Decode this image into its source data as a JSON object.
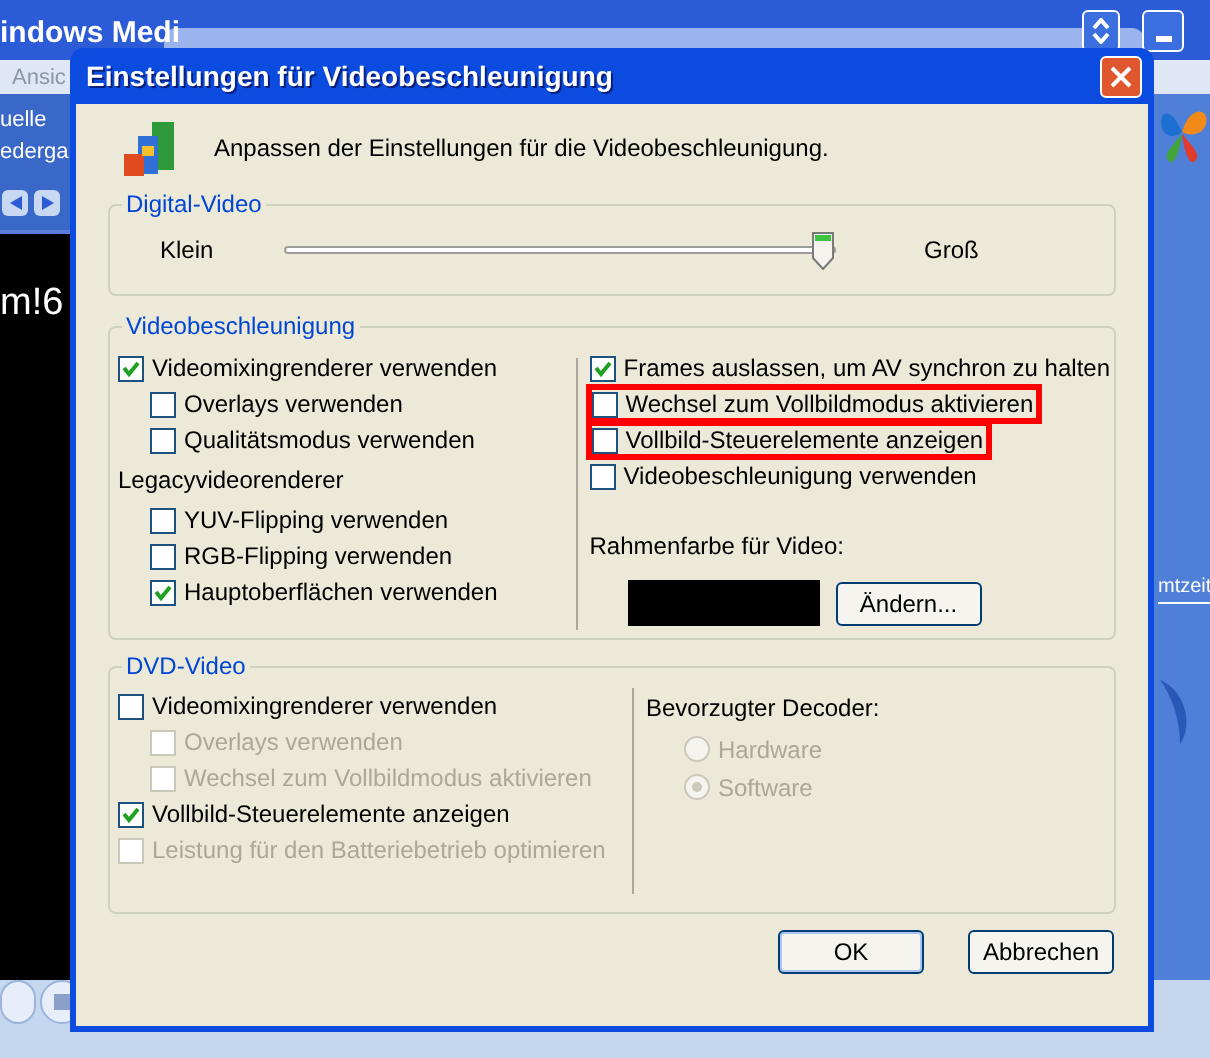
{
  "background": {
    "title_fragment": "indows Medi",
    "menu_fragment": "Ansic",
    "nav_fragments": [
      "uelle",
      "ederga"
    ],
    "video_text": "m!6",
    "side_fragment": "mtzeit"
  },
  "dialog": {
    "title": "Einstellungen für Videobeschleunigung",
    "description": "Anpassen der Einstellungen für die Videobeschleunigung.",
    "digital_video": {
      "legend": "Digital-Video",
      "min_label": "Klein",
      "max_label": "Groß",
      "slider": {
        "level": 0.98
      }
    },
    "video_acceleration": {
      "legend": "Videobeschleunigung",
      "left_items": [
        {
          "kind": "checkbox",
          "label": "Videomixingrenderer verwenden",
          "checked": true,
          "disabled": false,
          "indented": false,
          "highlighted": false
        },
        {
          "kind": "checkbox",
          "label": "Overlays verwenden",
          "checked": false,
          "disabled": false,
          "indented": true,
          "highlighted": false
        },
        {
          "kind": "checkbox",
          "label": "Qualitätsmodus verwenden",
          "checked": false,
          "disabled": false,
          "indented": true,
          "highlighted": false
        },
        {
          "kind": "heading",
          "label": "Legacyvideorenderer"
        },
        {
          "kind": "checkbox",
          "label": "YUV-Flipping verwenden",
          "checked": false,
          "disabled": false,
          "indented": true,
          "highlighted": false
        },
        {
          "kind": "checkbox",
          "label": "RGB-Flipping verwenden",
          "checked": false,
          "disabled": false,
          "indented": true,
          "highlighted": false
        },
        {
          "kind": "checkbox",
          "label": "Hauptoberflächen verwenden",
          "checked": true,
          "disabled": false,
          "indented": true,
          "highlighted": false
        }
      ],
      "right_items": [
        {
          "kind": "checkbox",
          "label": "Frames auslassen, um AV synchron zu halten",
          "checked": true,
          "disabled": false,
          "indented": false,
          "highlighted": false
        },
        {
          "kind": "checkbox",
          "label": "Wechsel zum Vollbildmodus aktivieren",
          "checked": false,
          "disabled": false,
          "indented": false,
          "highlighted": true
        },
        {
          "kind": "checkbox",
          "label": "Vollbild-Steuerelemente anzeigen",
          "checked": false,
          "disabled": false,
          "indented": false,
          "highlighted": true
        },
        {
          "kind": "checkbox",
          "label": "Videobeschleunigung verwenden",
          "checked": false,
          "disabled": false,
          "indented": false,
          "highlighted": false
        }
      ],
      "border_color_label": "Rahmenfarbe für Video:",
      "border_color": {
        "color": "#000000"
      },
      "change_button": "Ändern..."
    },
    "dvd_video": {
      "legend": "DVD-Video",
      "left_items": [
        {
          "kind": "checkbox",
          "label": "Videomixingrenderer verwenden",
          "checked": false,
          "disabled": false,
          "indented": false,
          "highlighted": false
        },
        {
          "kind": "checkbox",
          "label": "Overlays verwenden",
          "checked": false,
          "disabled": true,
          "indented": true,
          "highlighted": false
        },
        {
          "kind": "checkbox",
          "label": "Wechsel zum Vollbildmodus aktivieren",
          "checked": false,
          "disabled": true,
          "indented": true,
          "highlighted": false
        },
        {
          "kind": "checkbox",
          "label": "Vollbild-Steuerelemente anzeigen",
          "checked": true,
          "disabled": false,
          "indented": false,
          "highlighted": false
        },
        {
          "kind": "checkbox",
          "label": "Leistung für den Batteriebetrieb optimieren",
          "checked": false,
          "disabled": true,
          "indented": false,
          "highlighted": false
        }
      ],
      "decoder_label": "Bevorzugter Decoder:",
      "decoders": [
        {
          "label": "Hardware",
          "selected": false,
          "disabled": true
        },
        {
          "label": "Software",
          "selected": true,
          "disabled": true
        }
      ]
    },
    "buttons": [
      "OK",
      "Abbrechen"
    ]
  }
}
